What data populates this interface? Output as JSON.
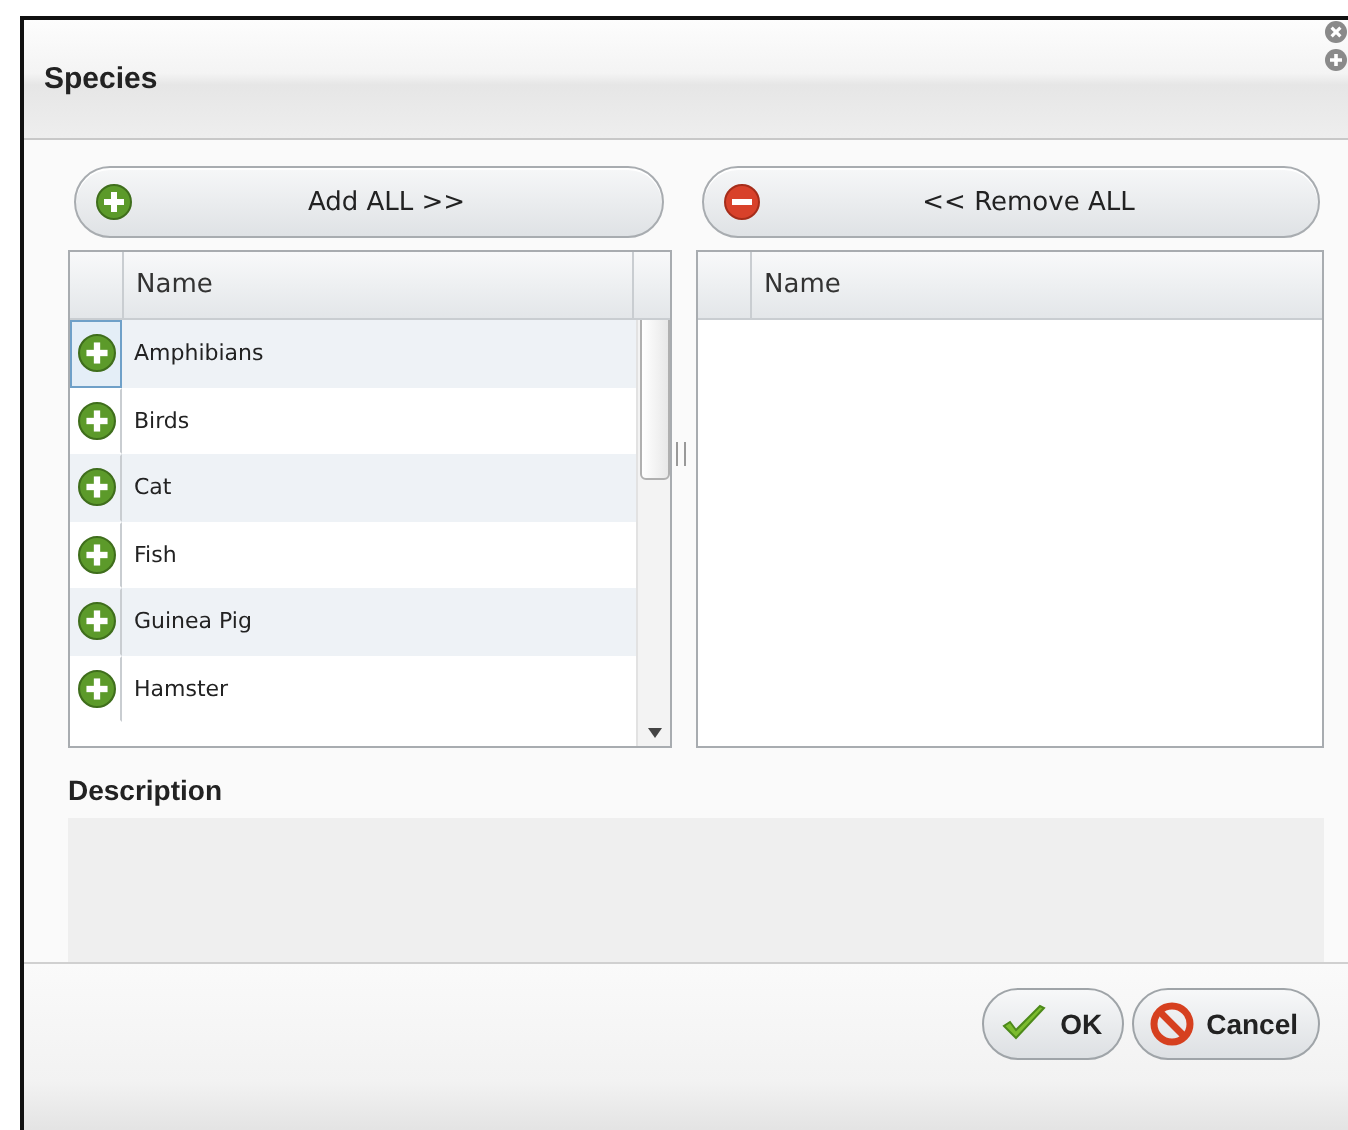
{
  "window": {
    "title": "Species"
  },
  "transfer_buttons": [
    {
      "kind": "add",
      "label": "Add ALL >>"
    },
    {
      "kind": "remove",
      "label": "<< Remove ALL"
    }
  ],
  "available": {
    "columns": [
      "Name"
    ],
    "rows": [
      {
        "name": "Amphibians",
        "selected": true
      },
      {
        "name": "Birds",
        "selected": false
      },
      {
        "name": "Cat",
        "selected": false
      },
      {
        "name": "Fish",
        "selected": false
      },
      {
        "name": "Guinea Pig",
        "selected": false
      },
      {
        "name": "Hamster",
        "selected": false
      }
    ]
  },
  "chosen": {
    "columns": [
      "Name"
    ]
  },
  "description": {
    "label": "Description"
  },
  "buttons": [
    {
      "kind": "ok",
      "label": "OK"
    },
    {
      "kind": "cancel",
      "label": "Cancel"
    }
  ]
}
